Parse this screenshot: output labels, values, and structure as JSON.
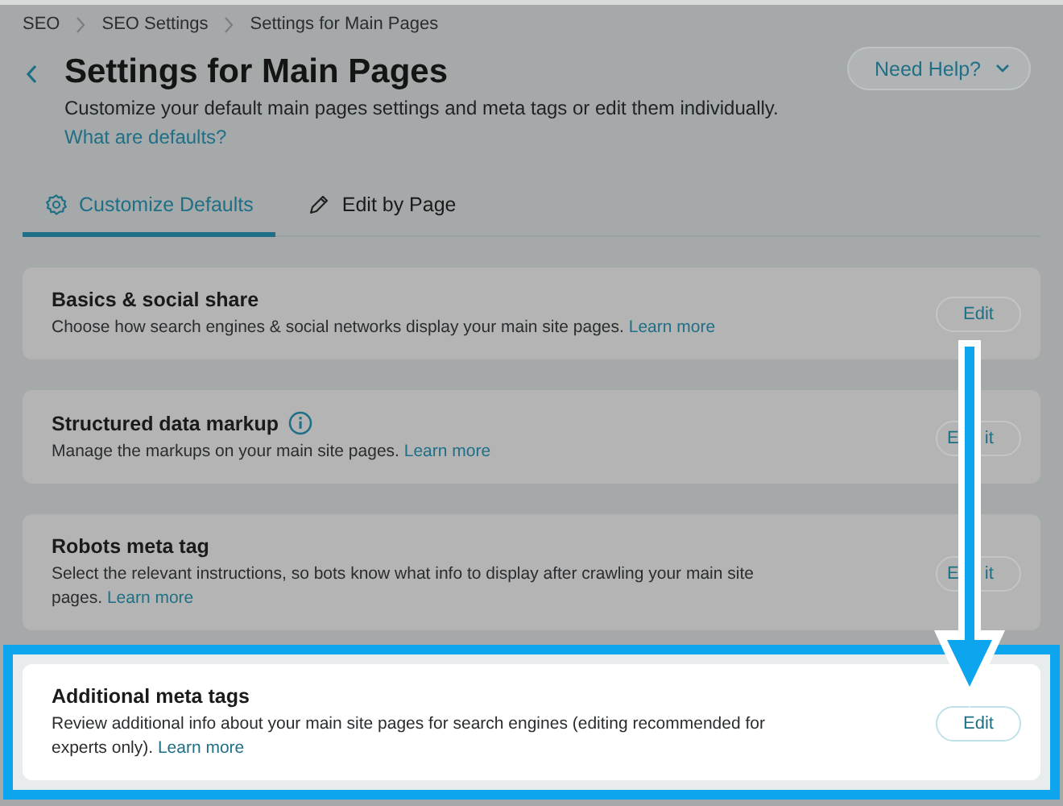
{
  "breadcrumb": [
    "SEO",
    "SEO Settings",
    "Settings for Main Pages"
  ],
  "header": {
    "title": "Settings for Main Pages",
    "subtitle": "Customize your default main pages settings and meta tags or edit them individually.",
    "link": "What are defaults?",
    "help_button": "Need Help?"
  },
  "tabs": [
    {
      "label": "Customize Defaults",
      "selected": true
    },
    {
      "label": "Edit by Page",
      "selected": false
    }
  ],
  "cards": [
    {
      "title": "Basics & social share",
      "info": false,
      "description": "Choose how search engines & social networks display your main site pages.",
      "link": "Learn more",
      "button": "Edit",
      "highlighted": false
    },
    {
      "title": "Structured data markup",
      "info": true,
      "description": "Manage the markups on your main site pages.",
      "link": "Learn more",
      "button": "E it",
      "highlighted": false
    },
    {
      "title": "Robots meta tag",
      "info": false,
      "description": "Select the relevant instructions, so bots know what info to display after crawling your main site pages.",
      "link": "Learn more",
      "button": "E it",
      "highlighted": false
    },
    {
      "title": "Additional meta tags",
      "info": false,
      "description": "Review additional info about your main site pages for search engines (editing recommended for experts only).",
      "link": "Learn more",
      "button": "Edit",
      "highlighted": true
    }
  ]
}
